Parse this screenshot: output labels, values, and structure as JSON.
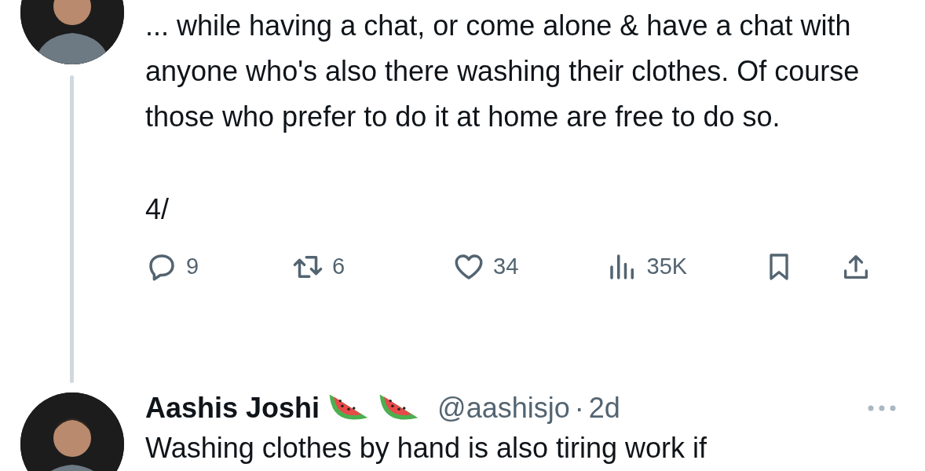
{
  "tweets": [
    {
      "text": "... while having a chat, or come alone & have a chat with anyone who's also there washing their clothes. Of course those who prefer to do it at home are free to do so.",
      "footer": "4/",
      "actions": {
        "replies": "9",
        "reposts": "6",
        "likes": "34",
        "views": "35K"
      }
    },
    {
      "name": "Aashis Joshi",
      "badges": [
        {
          "kind": "watermelon"
        },
        {
          "kind": "watermelon"
        }
      ],
      "handle": "@aashisjo",
      "separator": "·",
      "time": "2d",
      "text": "Washing clothes by hand is also tiring work if"
    }
  ]
}
